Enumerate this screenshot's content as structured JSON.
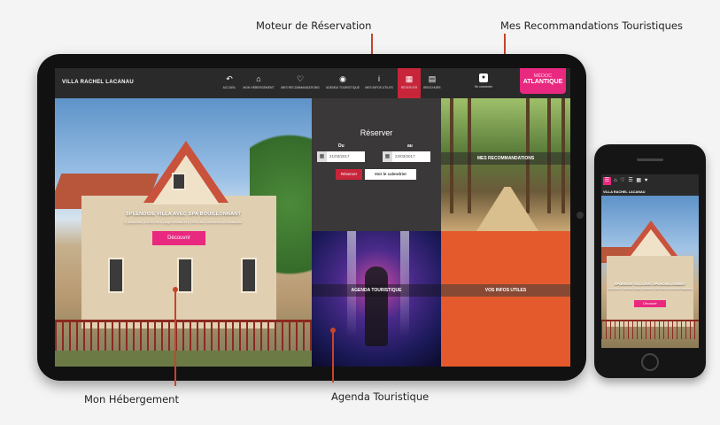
{
  "callouts": {
    "booking_engine": "Moteur de Réservation",
    "recommendations": "Mes Recommandations Touristiques",
    "accommodation": "Mon Hébergement",
    "agenda": "Agenda Touristique"
  },
  "site": {
    "brand": "VILLA RACHEL LACANAU",
    "nav": [
      {
        "label": "ACCUEIL",
        "icon": "back-arrow-icon"
      },
      {
        "label": "MON HÉBERGEMENT",
        "icon": "home-icon"
      },
      {
        "label": "MES RECOMMANDATIONS",
        "icon": "heart-icon"
      },
      {
        "label": "AGENDA TOURISTIQUE",
        "icon": "rss-icon"
      },
      {
        "label": "MES INFOS UTILES",
        "icon": "info-icon"
      },
      {
        "label": "RÉSERVER",
        "icon": "calendar-icon"
      },
      {
        "label": "BROCHURE",
        "icon": "pdf-icon"
      }
    ],
    "login_label": "Se connecter",
    "partner_logo": {
      "line1": "MÉDOC",
      "line2": "ATLANTIQUE"
    },
    "colors": {
      "accent": "#e9287f",
      "reserve": "#c8253b",
      "infos": "#e55a2c",
      "dark": "#3a3838"
    }
  },
  "hero": {
    "title": "SPLENDIDE VILLA AVEC SPA BOUILLONNANT",
    "subtitle": "6 personnes, à 400m de la plage centrale et à 100m des commerces et restaurants",
    "cta": "Découvrir"
  },
  "booking": {
    "heading": "Réserver",
    "from_label": "Du",
    "to_label": "au",
    "from_date": "21/03/2017",
    "to_date": "22/03/2017",
    "reserve_button": "Réserver",
    "calendar_button": "Voir le calendrier"
  },
  "tiles": {
    "recommendations": "MES RECOMMANDATIONS",
    "agenda": "AGENDA TOURISTIQUE",
    "infos": "VOS INFOS UTILES"
  },
  "phone": {
    "brand": "VILLA RACHEL LACANAU",
    "icons": "⌂ ♡ ☰ ▦ ♥",
    "menu_icon": "☰"
  }
}
